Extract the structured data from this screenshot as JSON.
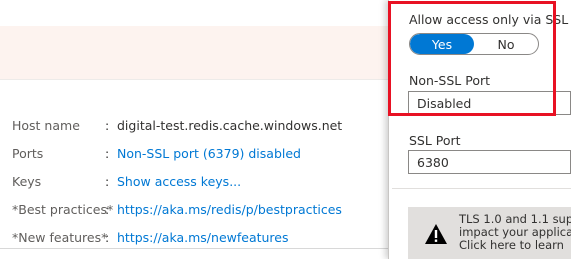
{
  "properties": [
    {
      "label": "Host name",
      "value": "digital-test.redis.cache.windows.net",
      "link": false
    },
    {
      "label": "Ports",
      "value": "Non-SSL port (6379) disabled",
      "link": true
    },
    {
      "label": "Keys",
      "value": "Show access keys...",
      "link": true
    },
    {
      "label": "*Best practices*",
      "value": "https://aka.ms/redis/p/bestpractices",
      "link": true
    },
    {
      "label": "*New features*",
      "value": "https://aka.ms/newfeatures",
      "link": true
    }
  ],
  "colon": ":",
  "ssl_panel": {
    "allow_ssl_label": "Allow access only via SSL",
    "toggle_yes": "Yes",
    "toggle_no": "No",
    "selected": "Yes",
    "non_ssl_port_label": "Non-SSL Port",
    "non_ssl_port_value": "Disabled",
    "ssl_port_label": "SSL Port",
    "ssl_port_value": "6380"
  },
  "warning": {
    "line1": "TLS 1.0 and 1.1 sup",
    "line2": "impact your applica",
    "line3": "Click here to learn"
  },
  "colors": {
    "accent": "#0078d4",
    "highlight": "#e81123",
    "notice_bg": "#fdf3ef",
    "warning_bg": "#e1dfdd"
  }
}
